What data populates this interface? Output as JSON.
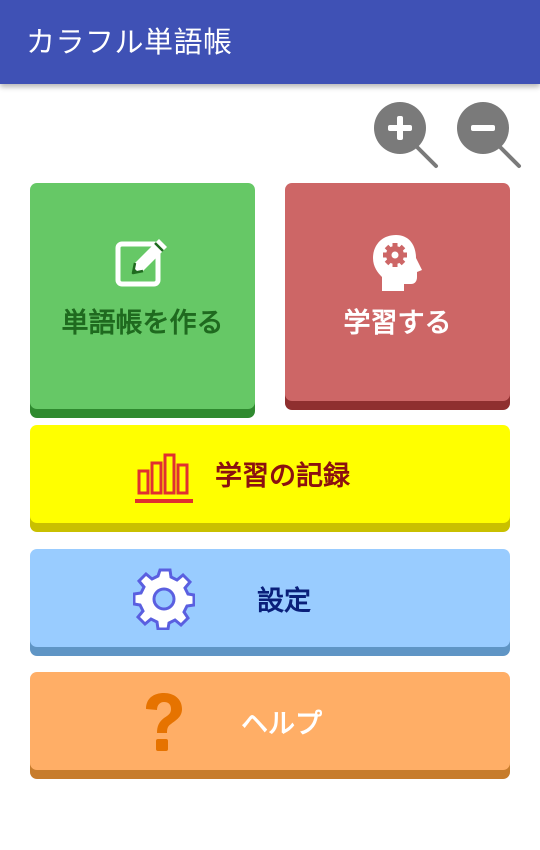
{
  "app": {
    "title": "カラフル単語帳"
  },
  "zoom": {
    "zoom_in_icon": "zoom-in-icon",
    "zoom_out_icon": "zoom-out-icon"
  },
  "menu": {
    "create": {
      "label": "単語帳を作る",
      "icon": "edit-icon",
      "color": "#66c866",
      "text_color": "#1f6a1f"
    },
    "study": {
      "label": "学習する",
      "icon": "head-gear-icon",
      "color": "#cd6666",
      "text_color": "#ffffff"
    },
    "record": {
      "label": "学習の記録",
      "icon": "bar-chart-icon",
      "color": "#ffff00",
      "text_color": "#8b1010"
    },
    "settings": {
      "label": "設定",
      "icon": "gear-icon",
      "color": "#99ccff",
      "text_color": "#0a1f7a"
    },
    "help": {
      "label": "ヘルプ",
      "icon": "question-icon",
      "color": "#ffae66",
      "text_color": "#ffffff"
    }
  },
  "colors": {
    "appbar": "#3f51b5",
    "zoom_icon": "#777777"
  }
}
